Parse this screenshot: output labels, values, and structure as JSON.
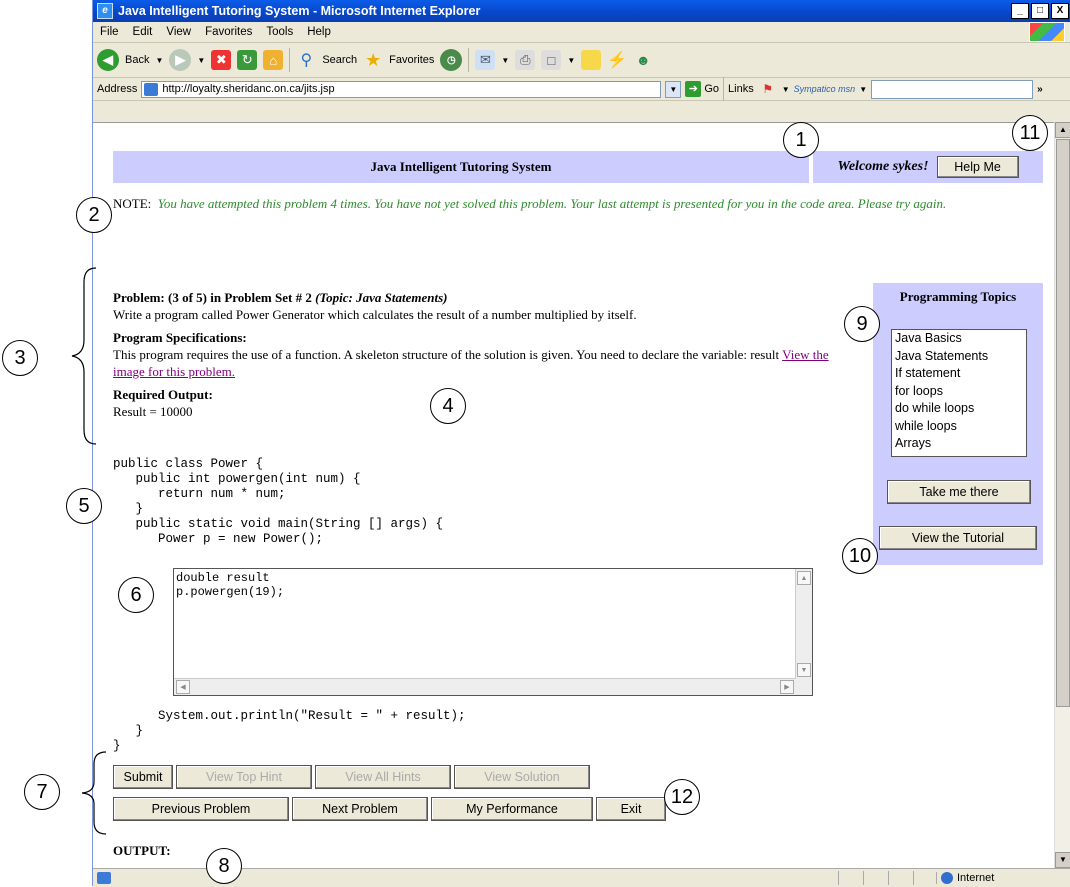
{
  "window": {
    "title": "Java Intelligent Tutoring System - Microsoft Internet Explorer",
    "controls": [
      "_",
      "□",
      "X"
    ]
  },
  "menubar": [
    "File",
    "Edit",
    "View",
    "Favorites",
    "Tools",
    "Help"
  ],
  "toolbar": {
    "back": "Back",
    "search": "Search",
    "favorites": "Favorites"
  },
  "addressbar": {
    "label": "Address",
    "url": "http://loyalty.sheridanc.on.ca/jits.jsp",
    "go": "Go",
    "links": "Links",
    "sympatico": "Sympatico msn"
  },
  "page": {
    "header_title": "Java Intelligent Tutoring System",
    "welcome": "Welcome sykes!",
    "help_button": "Help Me",
    "note_label": "NOTE:",
    "note_message": "You have attempted this problem 4 times.  You have not yet solved this problem.  Your last attempt is presented for you in the code area. Please try again.",
    "problem_heading": "Problem: (3 of 5) in Problem Set # 2",
    "problem_topic": "(Topic: Java Statements)",
    "problem_text": "Write a program called Power Generator which calculates the result of a number multiplied by itself.",
    "spec_heading": "Program Specifications:",
    "spec_text": "This program requires the use of a function. A skeleton structure of the solution is given. You need to declare the variable: result",
    "image_link": "View the image for this problem.",
    "output_heading": "Required Output:",
    "output_text": "Result = 10000",
    "code_top": "public class Power {\n   public int powergen(int num) {\n      return num * num;\n   }\n   public static void main(String [] args) {\n      Power p = new Power();",
    "editor_value": "double result\np.powergen(19);",
    "code_bottom": "      System.out.println(\"Result = \" + result);\n   }\n}",
    "buttons_row1": [
      "Submit",
      "View Top Hint",
      "View All Hints",
      "View Solution"
    ],
    "buttons_row2": [
      "Previous Problem",
      "Next Problem",
      "My Performance",
      "Exit"
    ],
    "output_label": "OUTPUT:"
  },
  "topics": {
    "title": "Programming Topics",
    "items": [
      "Java Basics",
      "Java Statements",
      "If statement",
      "for loops",
      "do while loops",
      "while loops",
      "Arrays"
    ],
    "take_button": "Take me there",
    "tutorial_button": "View the Tutorial"
  },
  "statusbar": {
    "zone": "Internet"
  },
  "callouts": [
    "1",
    "2",
    "3",
    "4",
    "5",
    "6",
    "7",
    "8",
    "9",
    "10",
    "11",
    "12"
  ]
}
